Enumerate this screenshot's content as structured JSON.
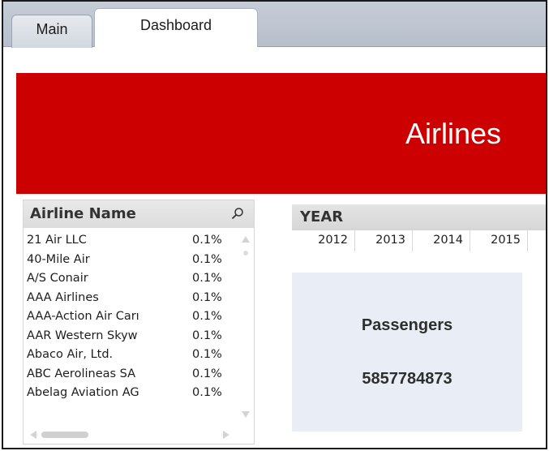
{
  "tabs": [
    {
      "label": "Main",
      "active": false
    },
    {
      "label": "Dashboard",
      "active": true
    }
  ],
  "banner": {
    "title": "Airlines",
    "color": "#cc0000"
  },
  "airline_list": {
    "title": "Airline Name",
    "search_icon": "search-icon",
    "rows": [
      {
        "name": "21 Air LLC",
        "pct": "0.1%"
      },
      {
        "name": "40-Mile Air",
        "pct": "0.1%"
      },
      {
        "name": "A/S Conair",
        "pct": "0.1%"
      },
      {
        "name": "AAA Airlines",
        "pct": "0.1%"
      },
      {
        "name": "AAA-Action Air Carı",
        "pct": "0.1%"
      },
      {
        "name": "AAR Western Skyw",
        "pct": "0.1%"
      },
      {
        "name": "Abaco Air, Ltd.",
        "pct": "0.1%"
      },
      {
        "name": "ABC Aerolineas SA",
        "pct": "0.1%"
      },
      {
        "name": "Abelag Aviation AG",
        "pct": "0.1%"
      }
    ]
  },
  "year_filter": {
    "title": "YEAR",
    "years": [
      "2012",
      "2013",
      "2014",
      "2015"
    ]
  },
  "kpi": {
    "label": "Passengers",
    "value": "5857784873",
    "background": "#e9eef6"
  }
}
